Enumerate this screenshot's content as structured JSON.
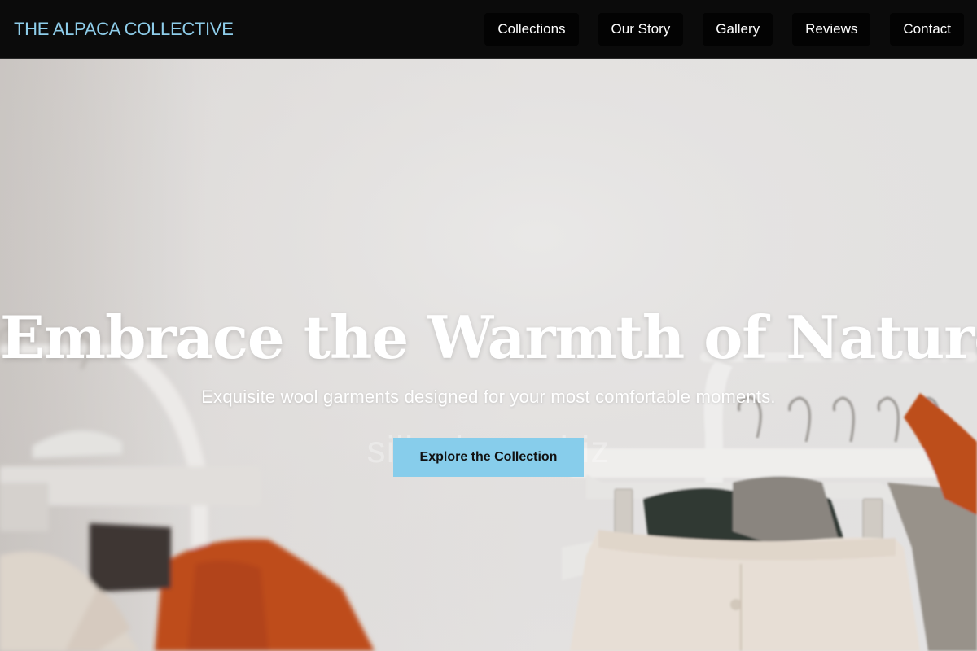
{
  "header": {
    "brand": "THE ALPACA COLLECTIVE",
    "nav": [
      {
        "label": "Collections"
      },
      {
        "label": "Our Story"
      },
      {
        "label": "Gallery"
      },
      {
        "label": "Reviews"
      },
      {
        "label": "Contact"
      }
    ]
  },
  "hero": {
    "title": "Embrace the Warmth of Nature",
    "subtitle": "Exquisite wool garments designed for your most comfortable moments.",
    "cta_label": "Explore the Collection",
    "watermark": "sillyalpaca.biz",
    "image": "clothing-rack-photo"
  },
  "colors": {
    "header_bg": "#0b0b0b",
    "brand": "#8ecdea",
    "nav_item_bg": "#030303",
    "cta_bg": "#87cdeb",
    "hero_text": "#ffffff"
  }
}
